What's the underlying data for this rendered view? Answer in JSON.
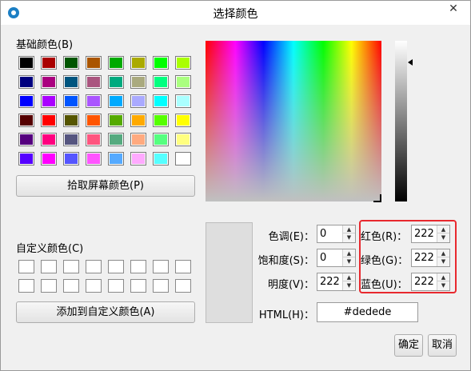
{
  "window": {
    "title": "选择颜色",
    "close_glyph": "✕"
  },
  "basic_colors": {
    "label": "基础颜色(B)",
    "swatches": [
      "#000000",
      "#aa0000",
      "#005500",
      "#aa5500",
      "#00aa00",
      "#aaaa00",
      "#00ff00",
      "#aaff00",
      "#00007f",
      "#aa007f",
      "#00557f",
      "#aa557f",
      "#00aa7f",
      "#aaaa7f",
      "#00ff7f",
      "#aaff7f",
      "#0000ff",
      "#aa00ff",
      "#0055ff",
      "#aa55ff",
      "#00aaff",
      "#aaaaff",
      "#00ffff",
      "#aaffff",
      "#550000",
      "#ff0000",
      "#555500",
      "#ff5500",
      "#55aa00",
      "#ffaa00",
      "#55ff00",
      "#ffff00",
      "#55007f",
      "#ff007f",
      "#55557f",
      "#ff557f",
      "#55aa7f",
      "#ffaa7f",
      "#55ff7f",
      "#ffff7f",
      "#5500ff",
      "#ff00ff",
      "#5555ff",
      "#ff55ff",
      "#55aaff",
      "#ffaaff",
      "#55ffff",
      "#ffffff"
    ]
  },
  "pick_screen_button": "拾取屏幕颜色(P)",
  "custom_colors": {
    "label": "自定义颜色(C)",
    "count": 16
  },
  "add_custom_button": "添加到自定义颜色(A)",
  "fields": {
    "hue": {
      "label": "色调(E)：",
      "value": "0"
    },
    "sat": {
      "label": "饱和度(S)：",
      "value": "0"
    },
    "val": {
      "label": "明度(V)：",
      "value": "222"
    },
    "red": {
      "label": "红色(R)：",
      "value": "222"
    },
    "green": {
      "label": "绿色(G)：",
      "value": "222"
    },
    "blue": {
      "label": "蓝色(U)：",
      "value": "222"
    },
    "html": {
      "label": "HTML(H)：",
      "value": "#dedede"
    }
  },
  "current_color": "#dedede",
  "highlight_color": "#e8282e",
  "buttons": {
    "ok": "确定",
    "cancel": "取消"
  }
}
